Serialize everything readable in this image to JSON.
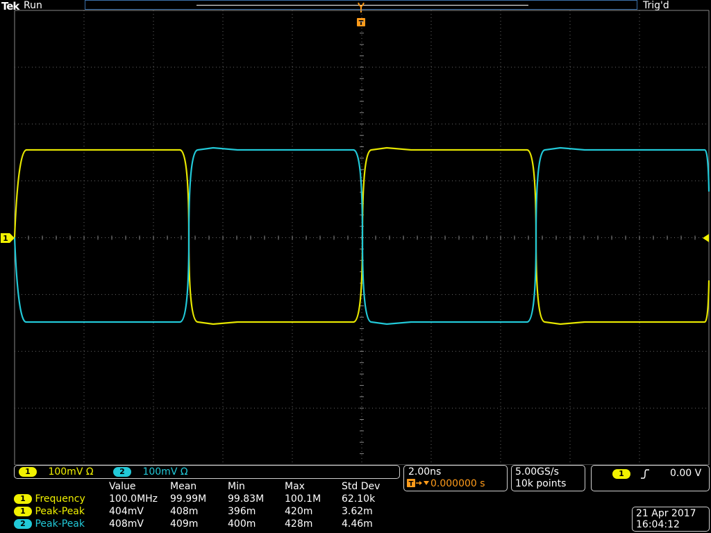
{
  "header": {
    "brand": "Tek",
    "run_state": "Run",
    "trigger_state": "Trig'd"
  },
  "trigger_marker": "T",
  "channel_marker": "1",
  "channels": [
    {
      "num": "1",
      "scale": "100mV",
      "coupling": "Ω",
      "color": "#f1f100"
    },
    {
      "num": "2",
      "scale": "100mV",
      "coupling": "Ω",
      "color": "#22c9d8"
    }
  ],
  "timebase": {
    "scale": "2.00ns",
    "delay": "0.000000 s",
    "sample_rate": "5.00GS/s",
    "record": "10k points"
  },
  "trigger": {
    "source": "1",
    "slope": "rising-edge-icon",
    "level": "0.00 V"
  },
  "measurements": {
    "headers": [
      "Value",
      "Mean",
      "Min",
      "Max",
      "Std Dev"
    ],
    "rows": [
      {
        "ch": "1",
        "name": "Frequency",
        "color": "#f1f100",
        "cells": [
          "100.0MHz",
          "99.99M",
          "99.83M",
          "100.1M",
          "62.10k"
        ]
      },
      {
        "ch": "1",
        "name": "Peak-Peak",
        "color": "#f1f100",
        "cells": [
          "404mV",
          "408m",
          "396m",
          "420m",
          "3.62m"
        ]
      },
      {
        "ch": "2",
        "name": "Peak-Peak",
        "color": "#22c9d8",
        "cells": [
          "408mV",
          "409m",
          "400m",
          "428m",
          "4.46m"
        ]
      }
    ]
  },
  "datetime": {
    "date": "21 Apr 2017",
    "time": "16:04:12"
  }
}
